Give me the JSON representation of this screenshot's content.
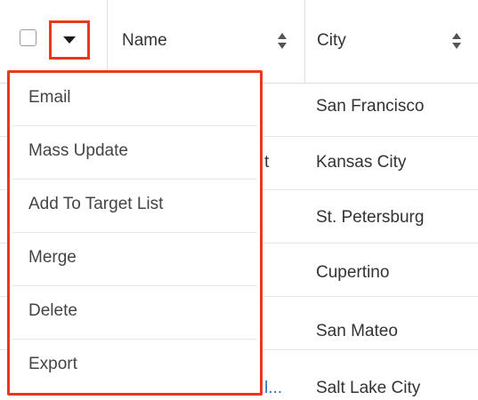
{
  "header": {
    "name_label": "Name",
    "city_label": "City"
  },
  "menu": {
    "items": [
      {
        "label": "Email"
      },
      {
        "label": "Mass Update"
      },
      {
        "label": "Add To Target List"
      },
      {
        "label": "Merge"
      },
      {
        "label": "Delete"
      },
      {
        "label": "Export"
      }
    ]
  },
  "rows": [
    {
      "city": "San Francisco",
      "name_fragment": ""
    },
    {
      "city": "Kansas City",
      "name_fragment": "t"
    },
    {
      "city": "St. Petersburg",
      "name_fragment": ""
    },
    {
      "city": "Cupertino",
      "name_fragment": ""
    },
    {
      "city": "San Mateo",
      "name_fragment": ""
    },
    {
      "city": "Salt Lake City",
      "name_fragment": "l..."
    }
  ],
  "icons": {
    "sort": "sort-icon",
    "caret": "caret-down-icon",
    "checkbox": "checkbox-icon"
  },
  "colors": {
    "highlight": "#e8391f",
    "link": "#1a73c9"
  }
}
